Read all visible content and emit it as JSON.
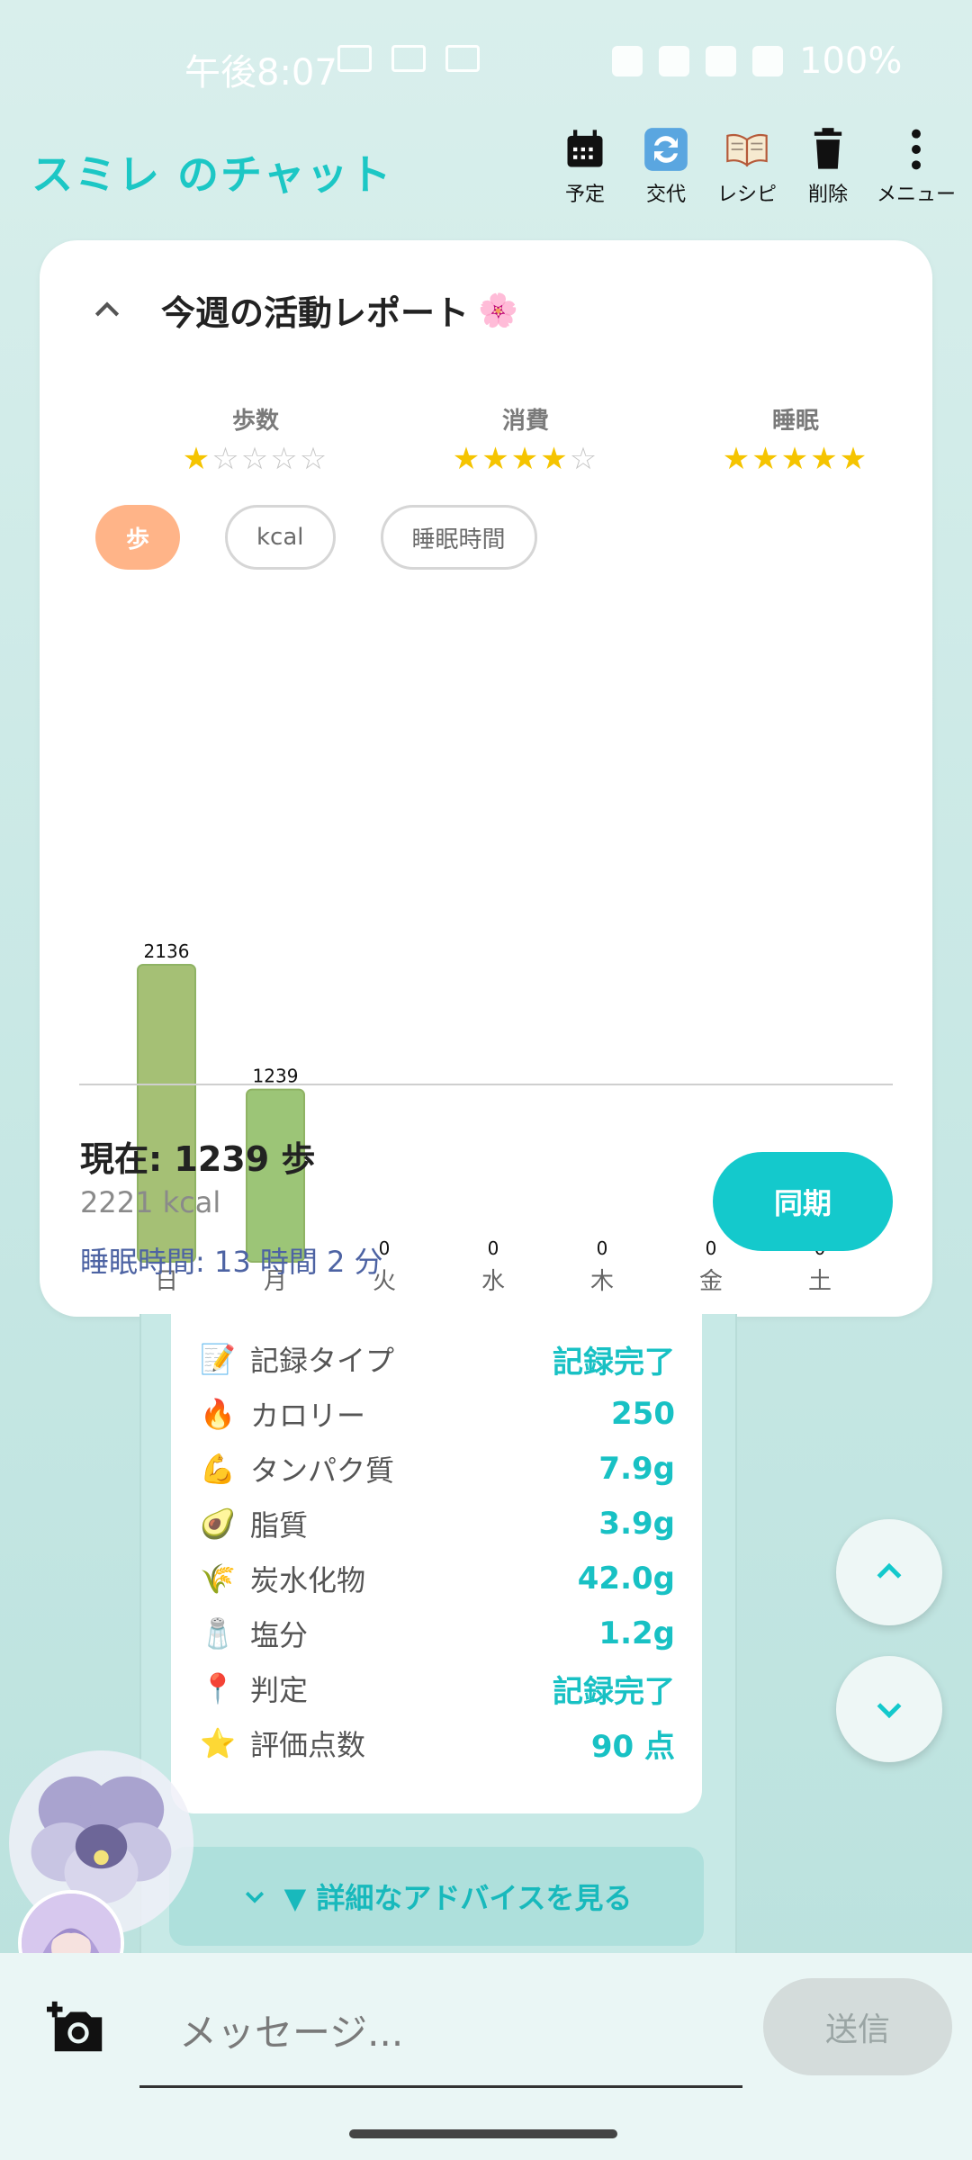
{
  "status_bar": {
    "time": "午後8:07",
    "battery": "100%"
  },
  "header": {
    "title": "スミレ のチャット",
    "tools": [
      {
        "label": "予定",
        "icon": "calendar-icon"
      },
      {
        "label": "交代",
        "icon": "swap-icon"
      },
      {
        "label": "レシピ",
        "icon": "book-icon"
      },
      {
        "label": "削除",
        "icon": "trash-icon"
      },
      {
        "label": "メニュー",
        "icon": "more-vert-icon"
      }
    ]
  },
  "report": {
    "title": "今週の活動レポート",
    "ratings": [
      {
        "label": "歩数",
        "stars": 1,
        "max": 5
      },
      {
        "label": "消費",
        "stars": 4,
        "max": 5
      },
      {
        "label": "睡眠",
        "stars": 5,
        "max": 5
      }
    ],
    "chips": [
      "歩",
      "kcal",
      "睡眠時間"
    ],
    "active_chip": "歩",
    "summary": {
      "now": "現在: 1239 歩",
      "kcal": "2221 kcal",
      "sleep": "睡眠時間: 13 時間 2 分"
    },
    "sync_label": "同期"
  },
  "chart_data": {
    "type": "bar",
    "categories": [
      "日",
      "月",
      "火",
      "水",
      "木",
      "金",
      "土"
    ],
    "values": [
      2136,
      1239,
      0,
      0,
      0,
      0,
      0
    ],
    "title": "",
    "xlabel": "",
    "ylabel": "",
    "colors": [
      "#a5c075",
      "#9cc577"
    ]
  },
  "nutrition": [
    {
      "icon": "📝",
      "label": "記録タイプ",
      "value": "記録完了"
    },
    {
      "icon": "🔥",
      "label": "カロリー",
      "value": "250"
    },
    {
      "icon": "💪",
      "label": "タンパク質",
      "value": "7.9g"
    },
    {
      "icon": "🥑",
      "label": "脂質",
      "value": "3.9g"
    },
    {
      "icon": "🌾",
      "label": "炭水化物",
      "value": "42.0g"
    },
    {
      "icon": "🧂",
      "label": "塩分",
      "value": "1.2g"
    },
    {
      "icon": "📍",
      "label": "判定",
      "value": "記録完了"
    },
    {
      "icon": "⭐",
      "label": "評価点数",
      "value": "90 点"
    }
  ],
  "advice_label": "▼ 詳細なアドバイスを見る",
  "input": {
    "placeholder": "メッセージ...",
    "send_label": "送信"
  },
  "colors": {
    "accent": "#14c9cc",
    "chip_active": "#ffb488",
    "bar": "#a5c075"
  }
}
